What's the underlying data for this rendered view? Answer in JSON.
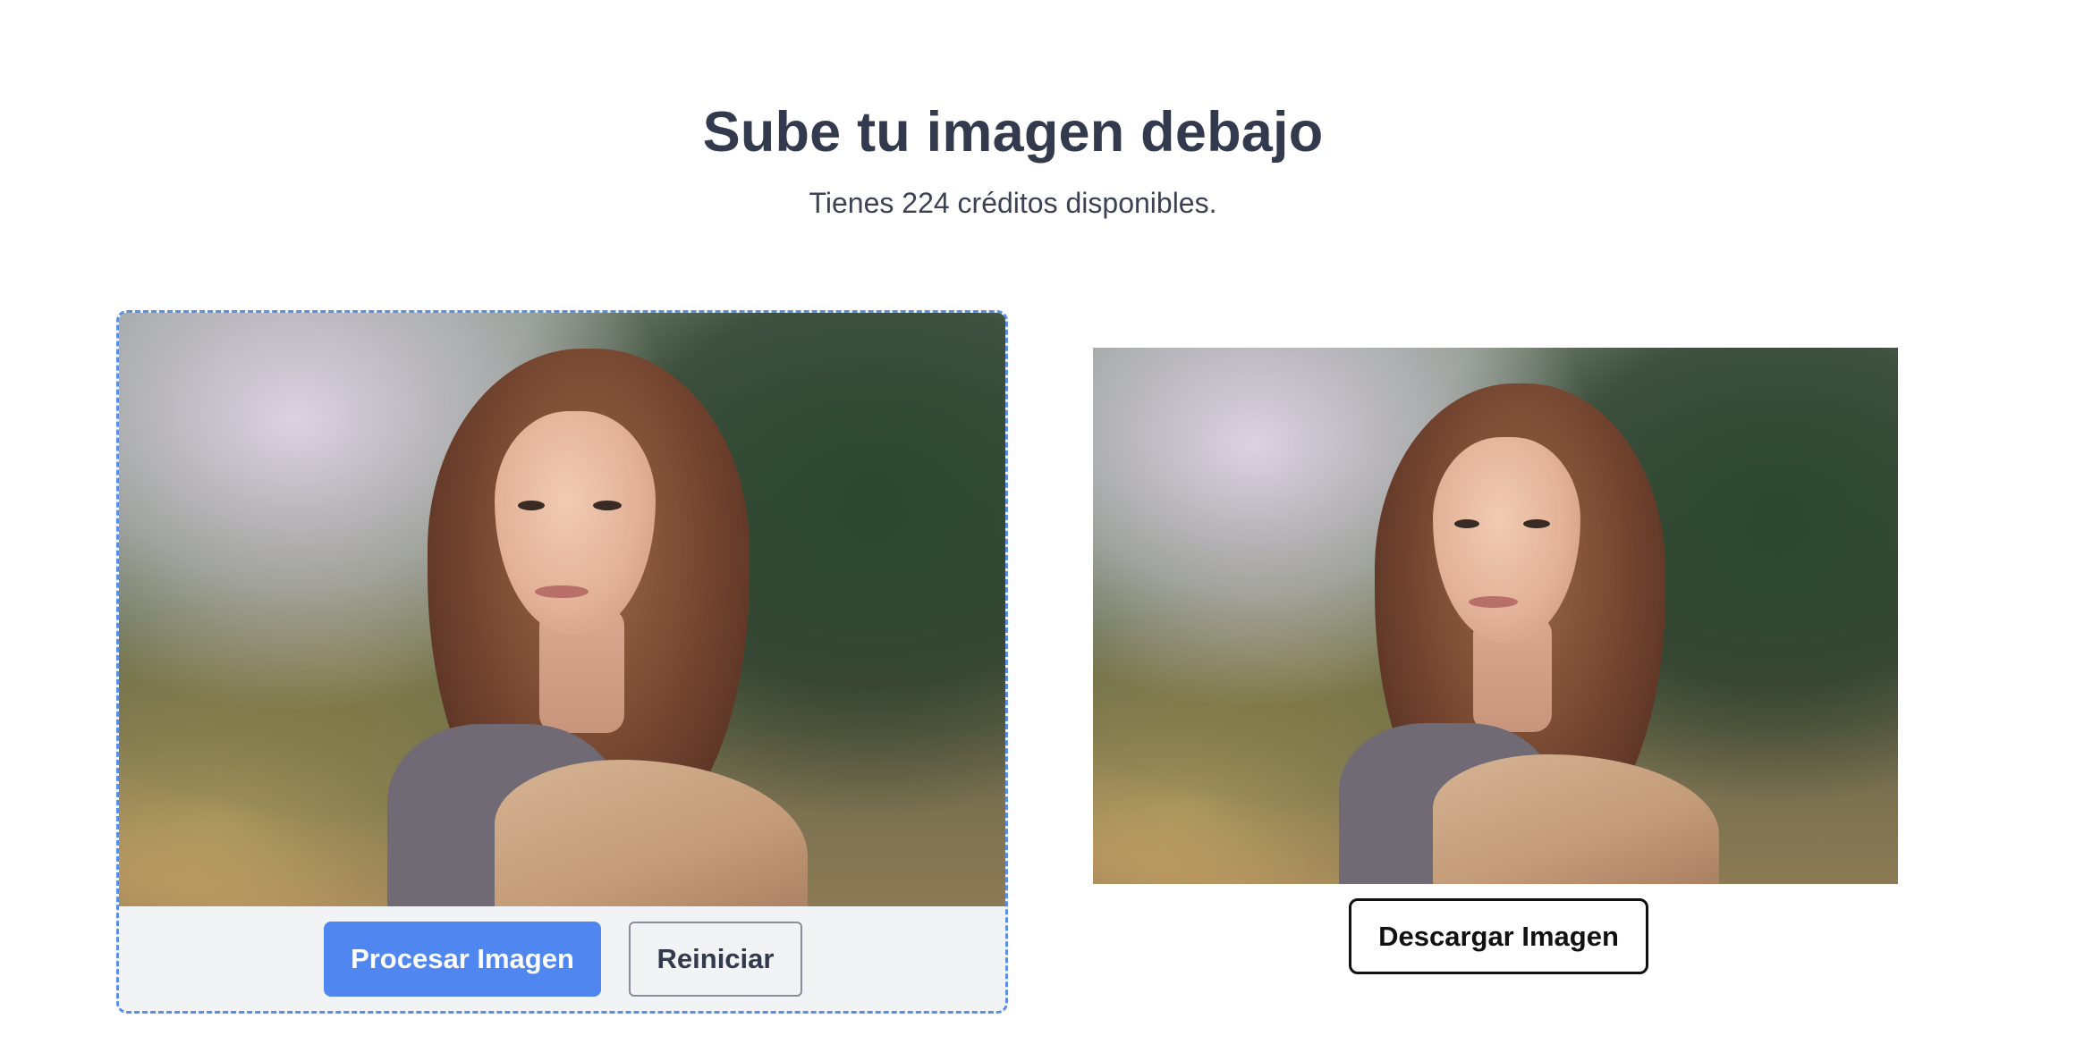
{
  "header": {
    "title": "Sube tu imagen debajo",
    "subtitle": "Tienes 224 créditos disponibles."
  },
  "upload": {
    "process_label": "Procesar Imagen",
    "reset_label": "Reiniciar"
  },
  "result": {
    "download_label": "Descargar Imagen"
  },
  "colors": {
    "accent": "#4f86f0",
    "dropzone_border": "#5b8fe6",
    "heading": "#333a4d",
    "panel_background": "#f2f3f5"
  }
}
